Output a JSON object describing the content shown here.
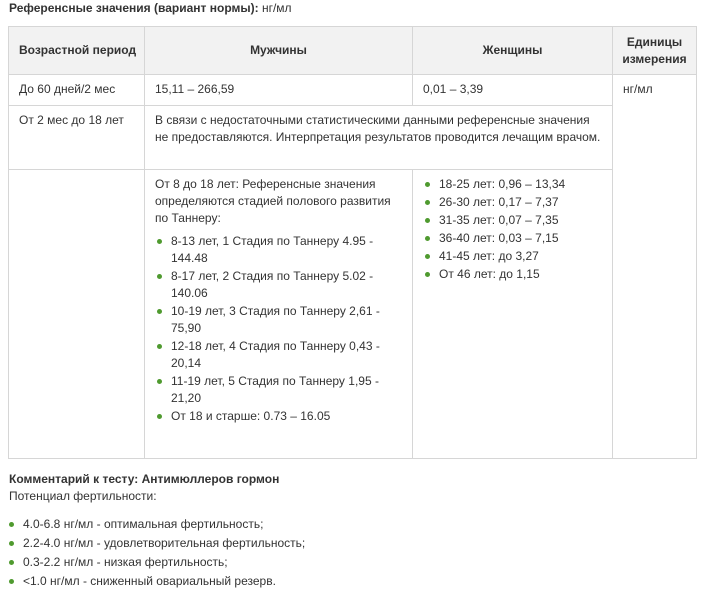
{
  "heading": {
    "bold": "Референсные значения (вариант нормы):",
    "unit": " нг/мл"
  },
  "table": {
    "headers": [
      "Возрастной период",
      "Мужчины",
      "Женщины",
      "Единицы измерения"
    ],
    "row1": {
      "age": "До 60 дней/2 мес",
      "men": "15,11 – 266,59",
      "women": "0,01 – 3,39",
      "units": "нг/мл"
    },
    "row2": {
      "age": "От 2 мес до 18 лет",
      "note": "В связи с недостаточными статистическими данными референсные значения не предоставляются. Интерпретация  результатов проводится лечащим врачом."
    },
    "row3": {
      "men_intro": "От 8 до 18 лет: Референсные значения определяются  стадией полового развития по Таннеру:",
      "men_items": [
        "8-13 лет, 1 Стадия по Таннеру   4.95 - 144.48",
        "8-17 лет, 2 Стадия по Таннеру   5.02 - 140.06",
        "10-19 лет, 3 Стадия по Таннеру   2,61 - 75,90",
        "12-18 лет, 4 Стадия по Таннеру   0,43 - 20,14",
        "11-19 лет, 5 Стадия  по Таннеру  1,95 - 21,20",
        "От 18 и старше: 0.73 – 16.05"
      ],
      "women_items": [
        "18-25 лет: 0,96 – 13,34",
        "26-30 лет: 0,17 – 7,37",
        "31-35 лет: 0,07 – 7,35",
        "36-40 лет: 0,03 – 7,15",
        "41-45 лет: до 3,27",
        "От 46 лет: до 1,15"
      ]
    }
  },
  "comment": {
    "title": "Комментарий к тесту: Антимюллеров гормон",
    "subtitle": "Потенциал фертильности:",
    "items": [
      "4.0-6.8 нг/мл - оптимальная фертильность;",
      "2.2-4.0 нг/мл - удовлетворительная фертильность;",
      "0.3-2.2 нг/мл - низкая фертильность;",
      "<1.0 нг/мл - сниженный овариальный резерв."
    ]
  },
  "colors": {
    "bullet": "#4f9a2f",
    "header_bg": "#f2f2f2",
    "border": "#d6d6d6"
  }
}
